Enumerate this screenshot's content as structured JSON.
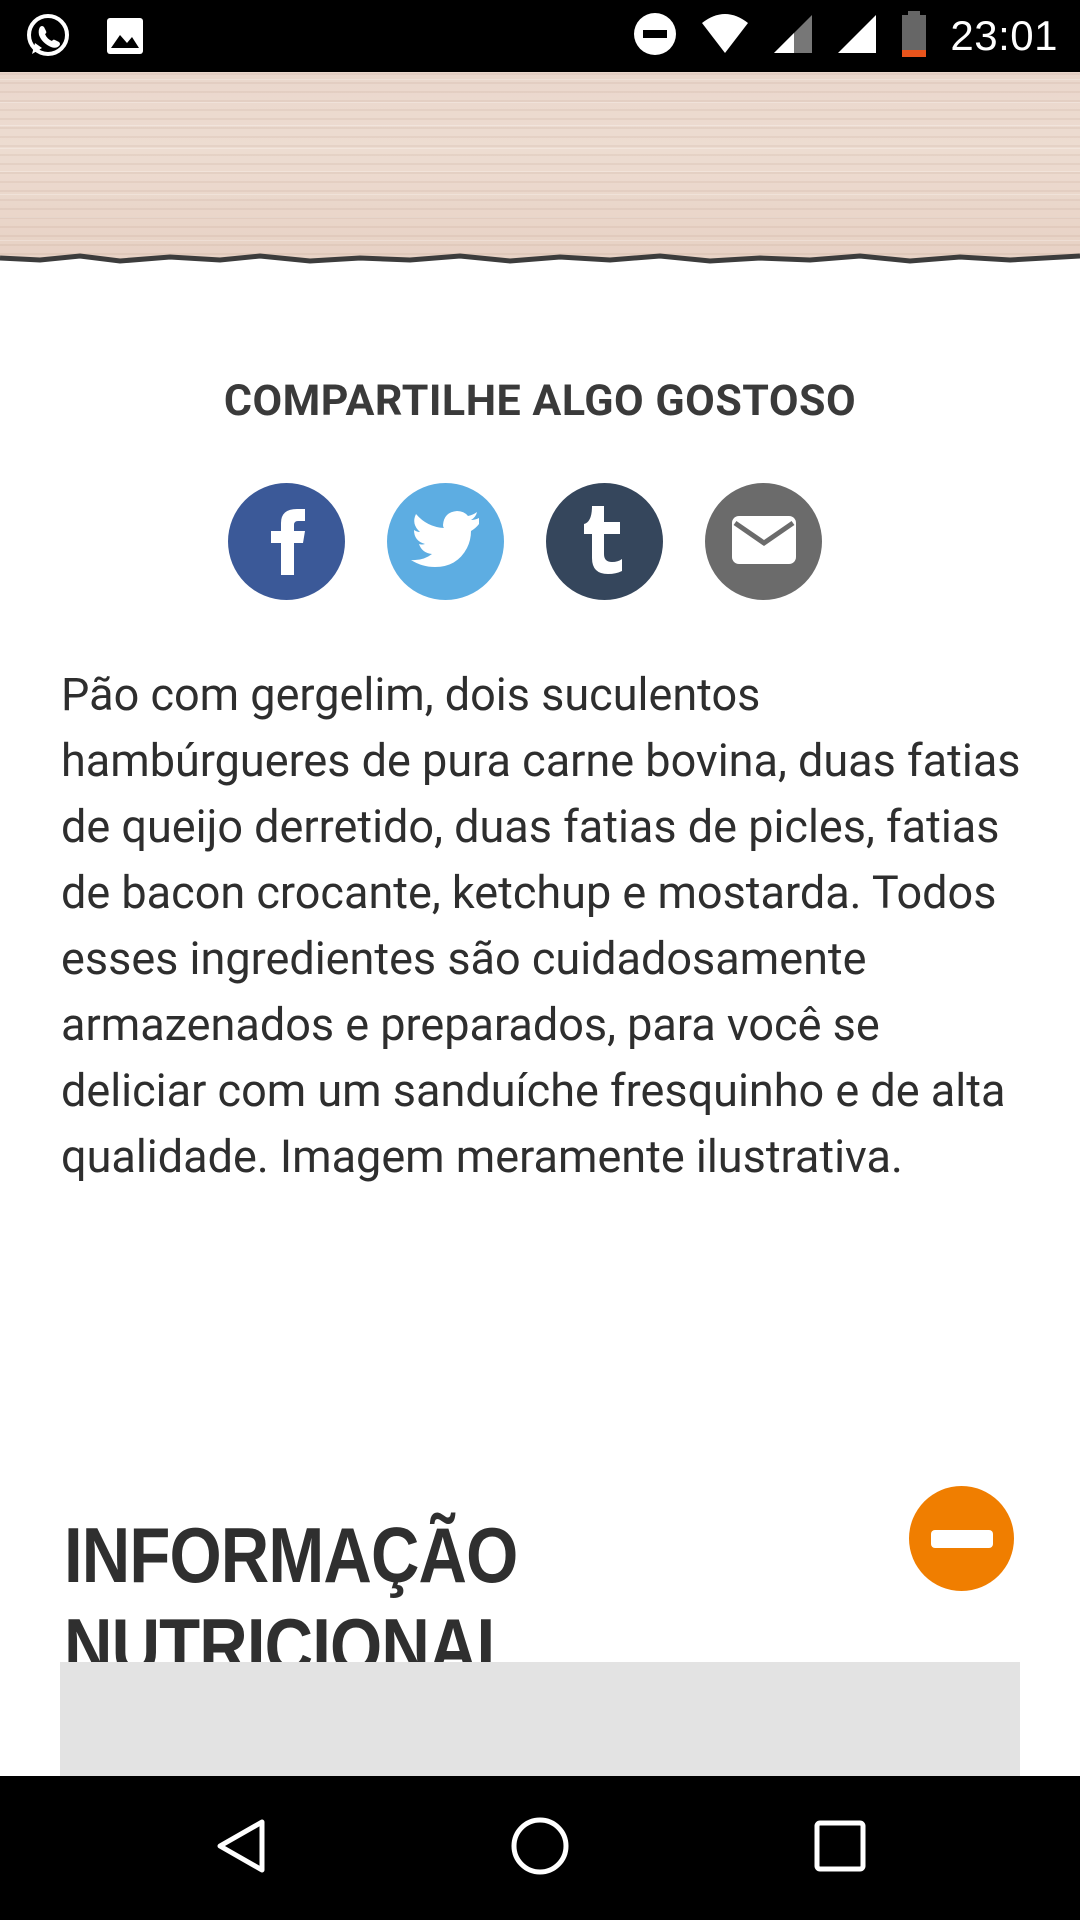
{
  "status_bar": {
    "time": "23:01",
    "icons": [
      "whatsapp-icon",
      "gallery-icon",
      "do-not-disturb-icon",
      "wifi-icon",
      "signal-icon",
      "signal-icon",
      "battery-icon"
    ]
  },
  "share": {
    "title": "COMPARTILHE ALGO GOSTOSO",
    "buttons": [
      {
        "name": "facebook",
        "color": "#3b5998"
      },
      {
        "name": "twitter",
        "color": "#5dade2"
      },
      {
        "name": "tumblr",
        "color": "#35465c"
      },
      {
        "name": "email",
        "color": "#6b6b6b"
      }
    ]
  },
  "description": "Pão com gergelim, dois suculentos hambúrgueres de pura carne bovina, duas fatias de queijo derretido, duas fatias de picles, fatias de bacon crocante, ketchup e mostarda. Todos esses ingredientes são cuidadosamente armazenados e preparados, para você se deliciar com um sanduíche fresquinho e de alta qualidade. Imagem meramente ilustrativa.",
  "nutrition": {
    "title": "INFORMAÇÃO NUTRICIONAL",
    "toggle_color": "#f07e00"
  },
  "nav_bar": {
    "buttons": [
      "back",
      "home",
      "recents"
    ]
  }
}
